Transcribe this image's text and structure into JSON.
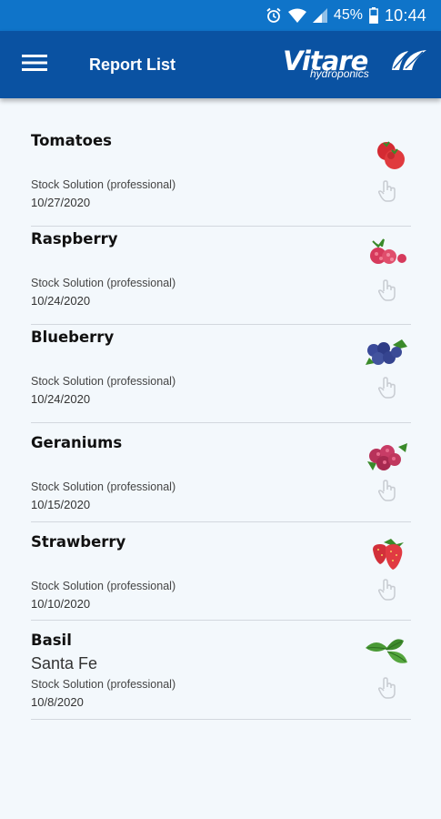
{
  "status_bar": {
    "battery": "45%",
    "time": "10:44",
    "icons": [
      "alarm-icon",
      "wifi-icon",
      "signal-icon",
      "battery-icon"
    ]
  },
  "app_bar": {
    "title": "Report List",
    "logo": {
      "brand": "Vitare",
      "subtitle": "hydroponics"
    },
    "background": "#0a52a2"
  },
  "reports": [
    {
      "name": "Tomatoes",
      "extra": "",
      "type": "Stock Solution (professional)",
      "date": "10/27/2020",
      "icon": "tomato-icon"
    },
    {
      "name": "Raspberry",
      "extra": "",
      "type": "Stock Solution (professional)",
      "date": "10/24/2020",
      "icon": "raspberry-icon"
    },
    {
      "name": "Blueberry",
      "extra": "",
      "type": "Stock Solution (professional)",
      "date": "10/24/2020",
      "icon": "blueberry-icon"
    },
    {
      "name": "Geraniums",
      "extra": "",
      "type": "Stock Solution (professional)",
      "date": "10/15/2020",
      "icon": "geranium-icon"
    },
    {
      "name": "Strawberry",
      "extra": "",
      "type": "Stock Solution (professional)",
      "date": "10/10/2020",
      "icon": "strawberry-icon"
    },
    {
      "name": "Basil",
      "extra": "Santa Fe",
      "type": "Stock Solution (professional)",
      "date": "10/8/2020",
      "icon": "basil-icon"
    }
  ]
}
